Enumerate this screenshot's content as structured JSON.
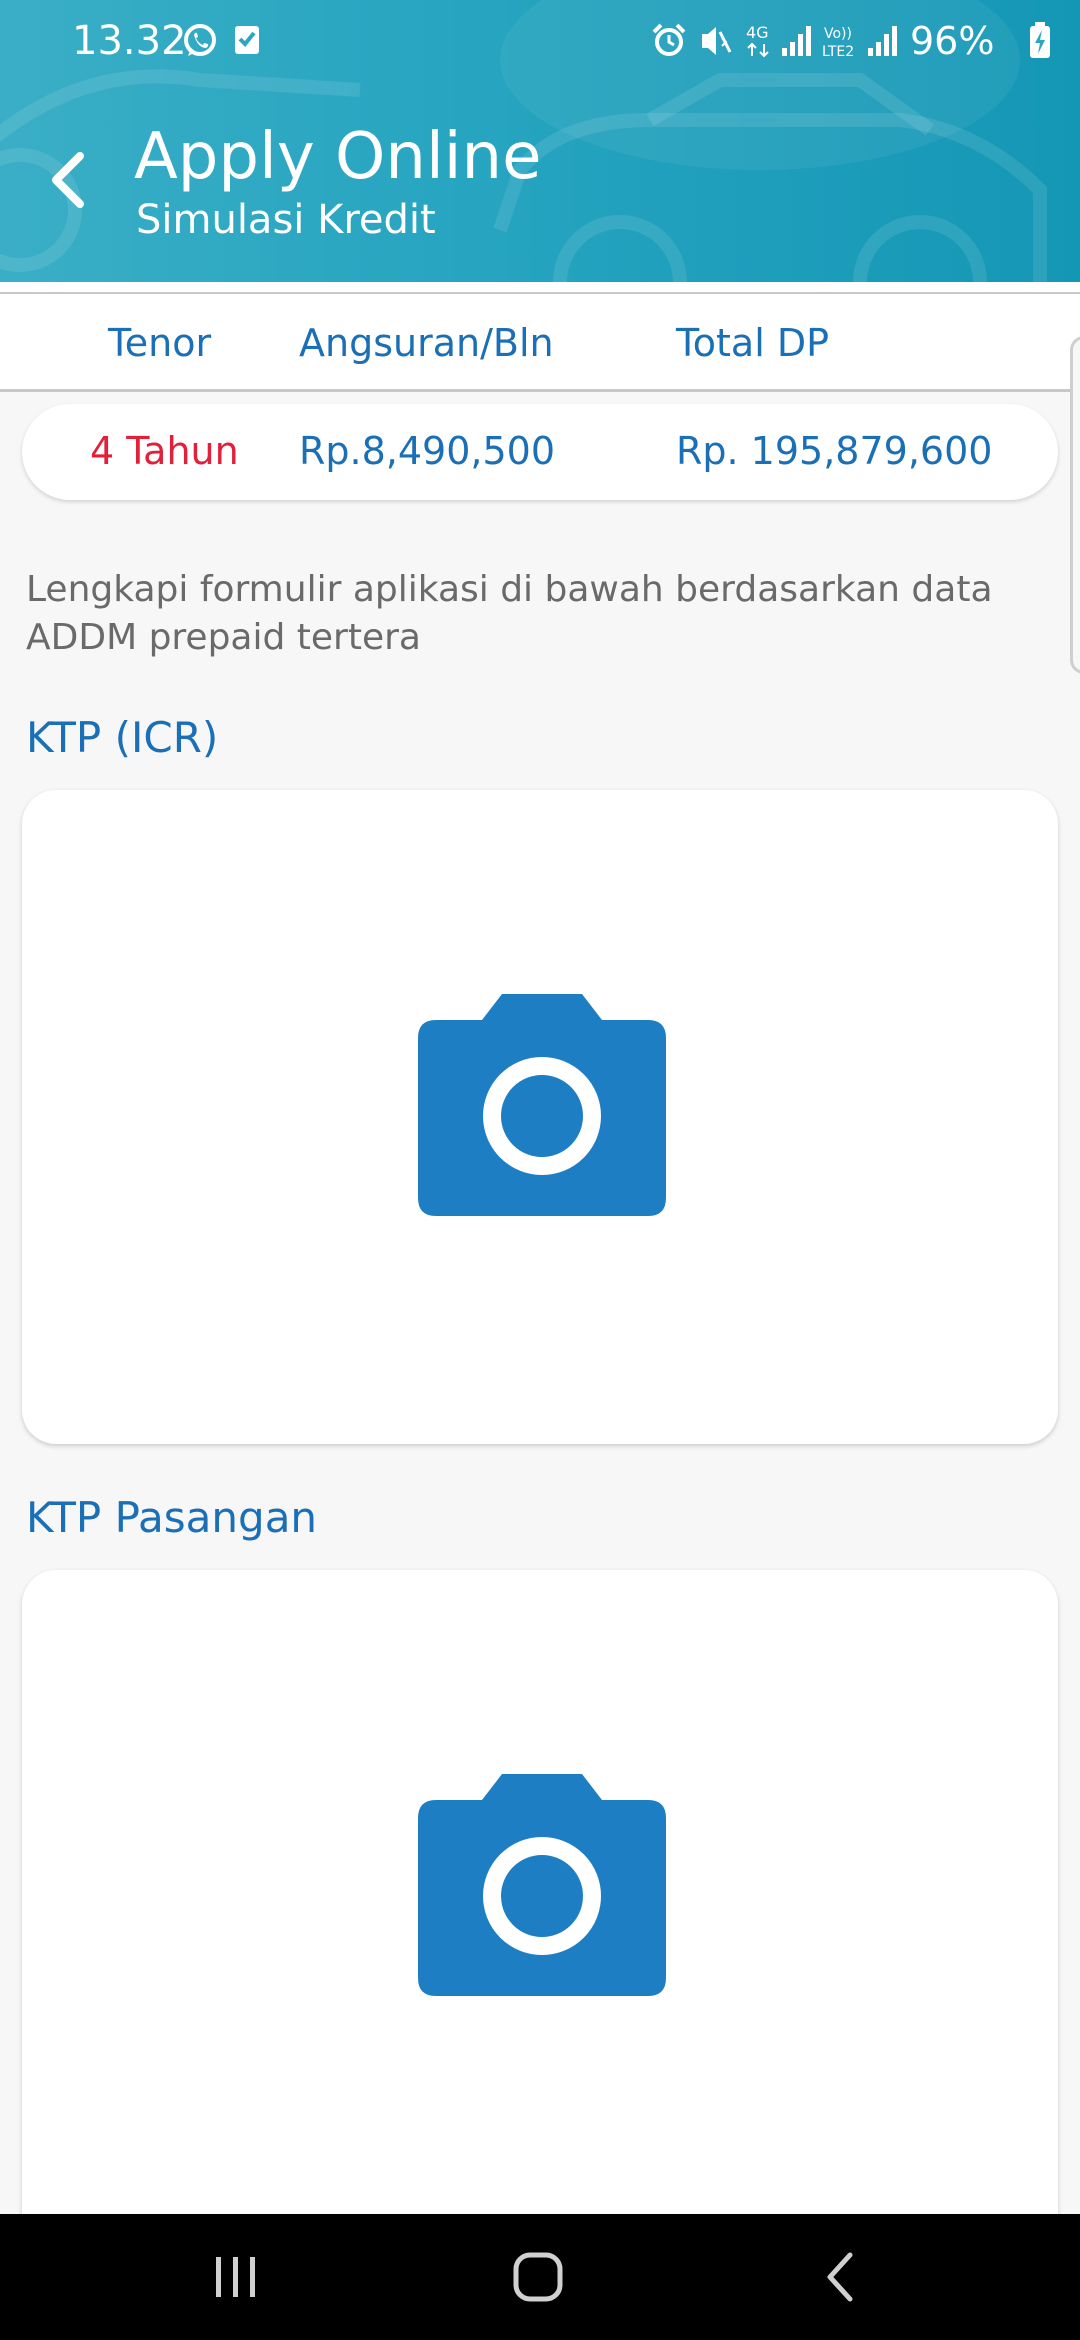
{
  "status_bar": {
    "time": "13.32",
    "battery": "96%",
    "icons": [
      "whatsapp-icon",
      "checkbox-notification-icon",
      "alarm-icon",
      "vibrate-mute-icon",
      "4g-data-icon",
      "signal-icon",
      "volte-lte2-icon",
      "signal-icon",
      "battery-charging-icon"
    ]
  },
  "app_bar": {
    "title": "Apply Online",
    "subtitle": "Simulasi Kredit",
    "back_icon": "chevron-left-icon"
  },
  "summary": {
    "headers": {
      "tenor": "Tenor",
      "angsuran": "Angsuran/Bln",
      "total_dp": "Total DP"
    },
    "values": {
      "tenor": "4 Tahun",
      "angsuran": "Rp.8,490,500",
      "total_dp": "Rp. 195,879,600"
    },
    "colors": {
      "label": "#1a6fb6",
      "tenor_value": "#e2203a"
    }
  },
  "instruction": "Lengkapi formulir aplikasi di bawah berdasarkan data ADDM prepaid tertera",
  "sections": [
    {
      "title": "KTP (ICR)",
      "icon": "camera-icon"
    },
    {
      "title": "KTP Pasangan",
      "icon": "camera-icon"
    }
  ],
  "nav_bar": {
    "recents_icon": "recent-apps-icon",
    "home_icon": "home-icon",
    "back_icon": "back-icon"
  },
  "colors": {
    "header_gradient_start": "#3aaec6",
    "header_gradient_end": "#1497b5",
    "accent_blue": "#1a6fb6",
    "camera_blue": "#1e7ec4"
  }
}
